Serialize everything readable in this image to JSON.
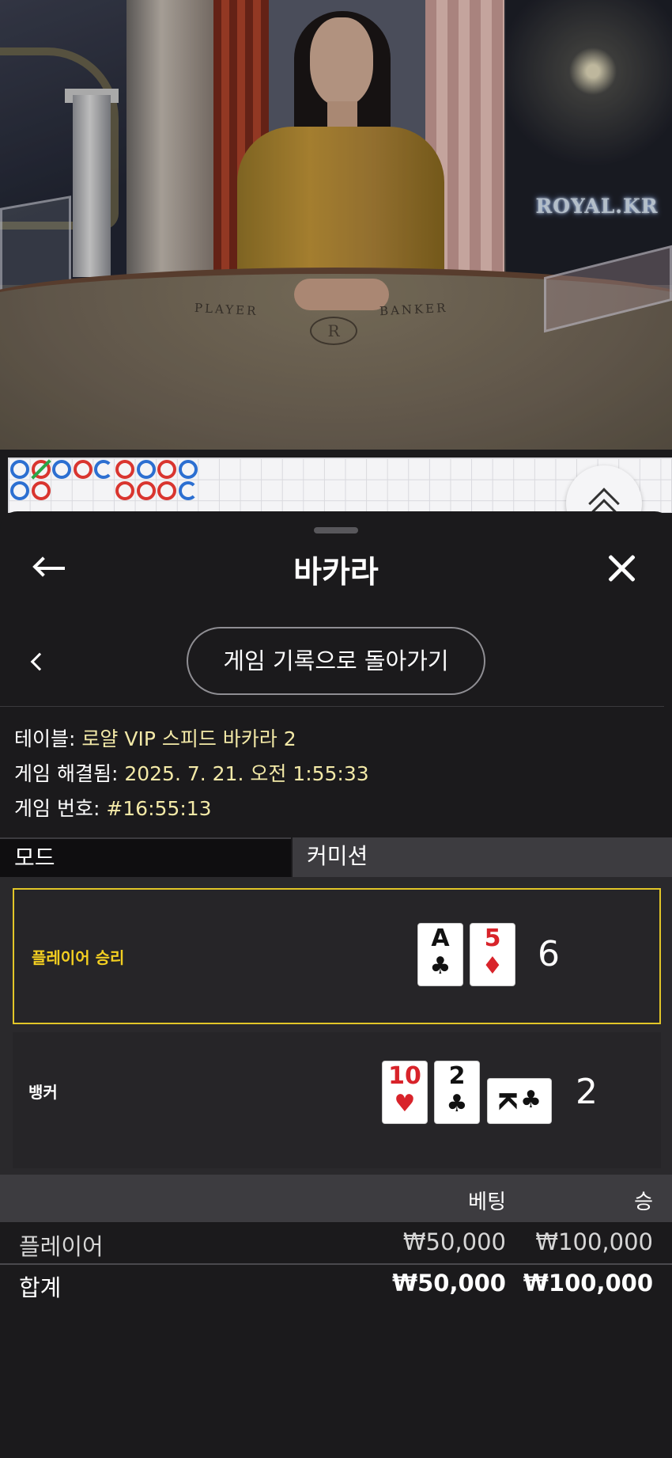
{
  "video": {
    "brand": "ROYAL.KR",
    "felt_player": "PLAYER",
    "felt_banker": "BANKER",
    "emblem": "R"
  },
  "roadmap": {
    "beads": [
      {
        "col": 0,
        "row": 0,
        "color": "blue"
      },
      {
        "col": 1,
        "row": 0,
        "color": "red",
        "mark": "slash"
      },
      {
        "col": 2,
        "row": 0,
        "color": "blue"
      },
      {
        "col": 3,
        "row": 0,
        "color": "red"
      },
      {
        "col": 4,
        "row": 0,
        "color": "blue",
        "open": true
      },
      {
        "col": 5,
        "row": 0,
        "color": "red"
      },
      {
        "col": 6,
        "row": 0,
        "color": "blue"
      },
      {
        "col": 7,
        "row": 0,
        "color": "red"
      },
      {
        "col": 8,
        "row": 0,
        "color": "blue"
      },
      {
        "col": 0,
        "row": 1,
        "color": "blue"
      },
      {
        "col": 1,
        "row": 1,
        "color": "red"
      },
      {
        "col": 5,
        "row": 1,
        "color": "red"
      },
      {
        "col": 6,
        "row": 1,
        "color": "red"
      },
      {
        "col": 7,
        "row": 1,
        "color": "red"
      },
      {
        "col": 8,
        "row": 1,
        "color": "blue",
        "open": true
      }
    ]
  },
  "header": {
    "title": "바카라"
  },
  "history_button": "게임 기록으로 돌아가기",
  "info": {
    "table_label": "테이블:",
    "table_value": "로얄 VIP 스피드 바카라 2",
    "resolved_label": "게임 해결됨:",
    "resolved_value": "2025. 7. 21. 오전 1:55:33",
    "number_label": "게임 번호:",
    "number_value": "#16:55:13"
  },
  "tabs": {
    "mode": "모드",
    "commission": "커미션"
  },
  "result": {
    "player": {
      "label": "플레이어 승리",
      "score": "6",
      "cards": [
        {
          "rank": "A",
          "suit": "♣",
          "color": "black"
        },
        {
          "rank": "5",
          "suit": "♦",
          "color": "red"
        }
      ]
    },
    "banker": {
      "label": "뱅커",
      "score": "2",
      "cards": [
        {
          "rank": "10",
          "suit": "♥",
          "color": "red"
        },
        {
          "rank": "2",
          "suit": "♣",
          "color": "black"
        },
        {
          "rank": "K",
          "suit": "♣",
          "color": "black",
          "sideways": true
        }
      ]
    }
  },
  "bets": {
    "col_bet": "베팅",
    "col_win": "승",
    "rows": [
      {
        "label": "플레이어",
        "bet": "₩50,000",
        "win": "₩100,000"
      },
      {
        "label": "합계",
        "bet": "₩50,000",
        "win": "₩100,000"
      }
    ]
  },
  "colors": {
    "accent_yellow": "#e2c628",
    "info_value": "#f3e9a7",
    "banker_red": "#d9352f",
    "player_blue": "#2c6fd1"
  }
}
